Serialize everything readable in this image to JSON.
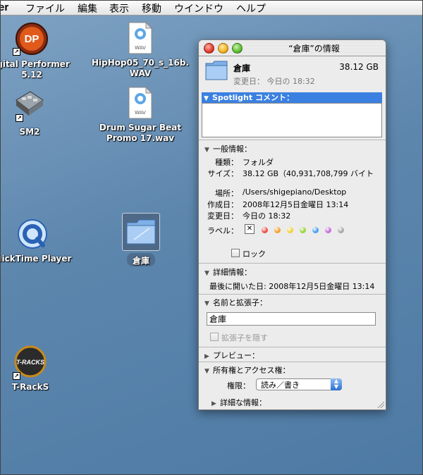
{
  "menubar": {
    "app": "er",
    "items": [
      "ファイル",
      "編集",
      "表示",
      "移動",
      "ウインドウ",
      "ヘルプ"
    ]
  },
  "desktop": {
    "icons": [
      {
        "label_lines": [
          "igital Performer",
          "5.12"
        ],
        "icon": "digital-performer-icon"
      },
      {
        "label_lines": [
          "SM2"
        ],
        "icon": "sm2-icon"
      },
      {
        "label_lines": [
          "uickTime Player"
        ],
        "icon": "quicktime-icon"
      },
      {
        "label_lines": [
          "T-RackS"
        ],
        "icon": "t-racks-icon"
      },
      {
        "label_lines": [
          "HipHop05_70_s_16b.",
          "WAV"
        ],
        "icon": "wav-file-icon"
      },
      {
        "label_lines": [
          "Drum Sugar Beat",
          "Promo 17.wav"
        ],
        "icon": "wav-file-icon"
      },
      {
        "label_lines": [
          "倉庫"
        ],
        "icon": "folder-icon"
      }
    ],
    "wav_badge": "WAV",
    "dp_badge": "DP",
    "tracks_badge": "T-RACKS"
  },
  "info_window": {
    "title": "“倉庫”の情報",
    "name": "倉庫",
    "size_summary": "38.12 GB",
    "modified_summary": "変更日：  今日の 18:32",
    "spotlight_header": "Spotlight コメント：",
    "general": {
      "header": "一般情報：",
      "kind_label": "種類：",
      "kind": "フォルダ",
      "size_label": "サイズ：",
      "size": "38.12 GB（40,931,708,799 バイト",
      "where_label": "場所：",
      "where": "/Users/shigepiano/Desktop",
      "created_label": "作成日：",
      "created": "2008年12月5日金曜日 13:14",
      "modified_label": "変更日：",
      "modified": "今日の 18:32",
      "label_label": "ラベル：",
      "label_colors": [
        "#f0504a",
        "#f5a22a",
        "#f2d43a",
        "#9bd63c",
        "#4aa3f0",
        "#c670d8",
        "#a9a9a9"
      ],
      "lock": "ロック"
    },
    "more_info": {
      "header": "詳細情報：",
      "last_opened": "最後に開いた日: 2008年12月5日金曜日 13:14"
    },
    "name_ext": {
      "header": "名前と拡張子：",
      "value": "倉庫",
      "hide_ext": "拡張子を隠す"
    },
    "preview": {
      "header": "プレビュー："
    },
    "ownership": {
      "header": "所有権とアクセス権：",
      "perm_label": "権限：",
      "perm_value": "読み／書き",
      "details": "詳細な情報："
    }
  }
}
